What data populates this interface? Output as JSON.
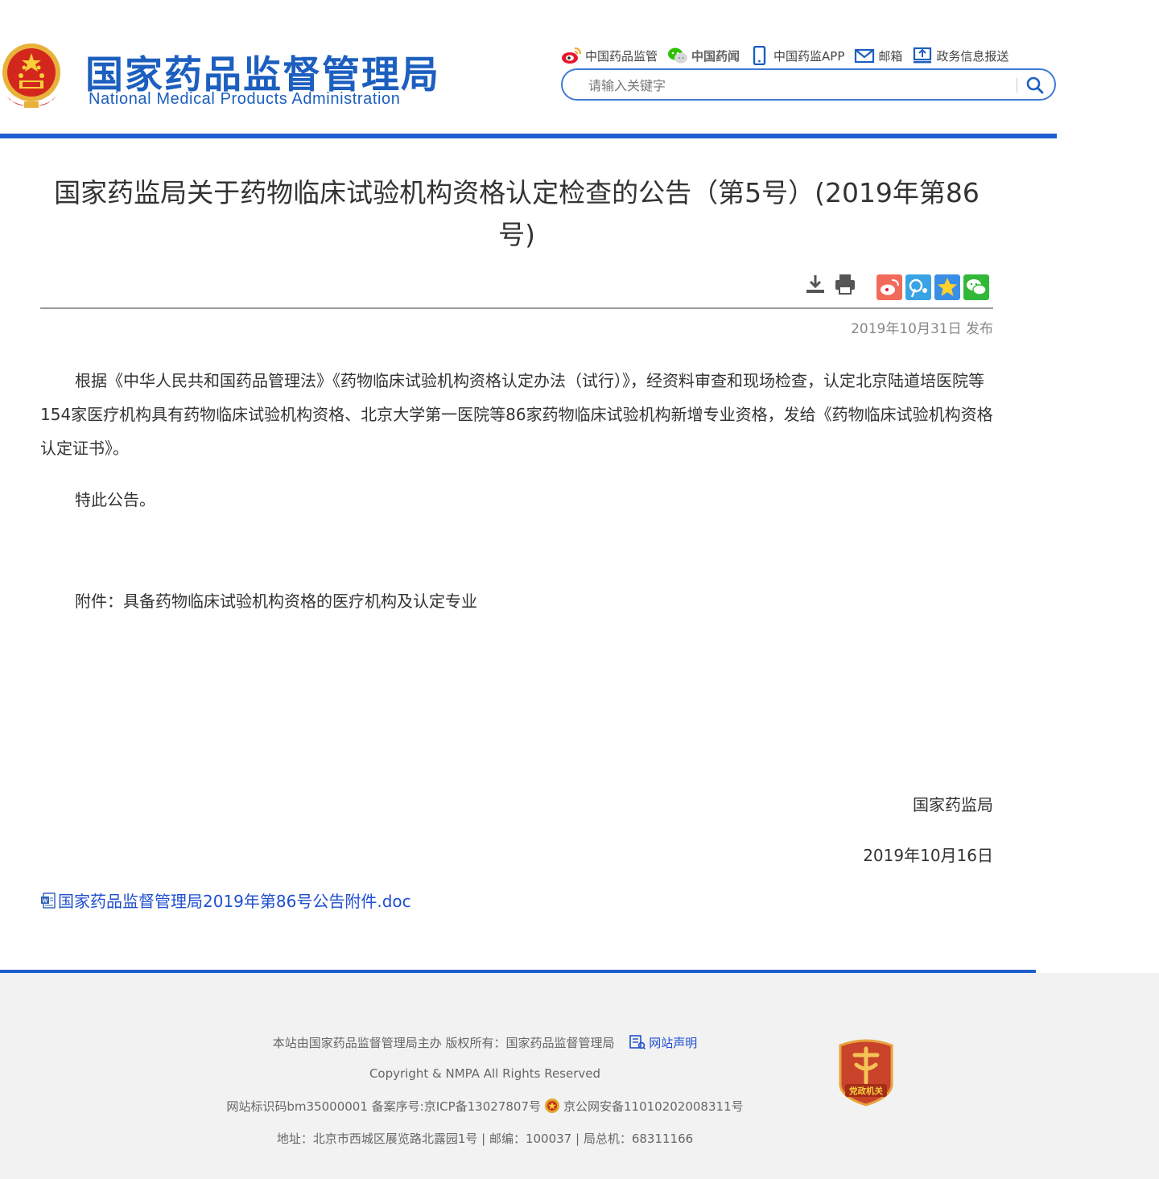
{
  "header": {
    "brand_cn": "国家药品监督管理局",
    "brand_en": "National Medical Products Administration",
    "links": [
      {
        "label": "中国药品监管",
        "icon": "weibo-icon"
      },
      {
        "label": "中国药闻",
        "icon": "wechat-icon"
      },
      {
        "label": "中国药监APP",
        "icon": "mobile-icon"
      },
      {
        "label": "邮箱",
        "icon": "mail-icon"
      },
      {
        "label": "政务信息报送",
        "icon": "upload-monitor-icon"
      }
    ],
    "search_placeholder": "请输入关键字"
  },
  "article": {
    "title": "国家药监局关于药物临床试验机构资格认定检查的公告（第5号）(2019年第86号)",
    "pubdate": "2019年10月31日 发布",
    "paragraphs": [
      "根据《中华人民共和国药品管理法》《药物临床试验机构资格认定办法（试行）》，经资料审查和现场检查，认定北京陆道培医院等154家医疗机构具有药物临床试验机构资格、北京大学第一医院等86家药物临床试验机构新增专业资格，发给《药物临床试验机构资格认定证书》。",
      "特此公告。",
      "附件：具备药物临床试验机构资格的医疗机构及认定专业"
    ],
    "signature_org": "国家药监局",
    "signature_date": "2019年10月16日",
    "attachment": "国家药品监督管理局2019年第86号公告附件.doc"
  },
  "footer": {
    "sponsor": "本站由国家药品监督管理局主办  版权所有：国家药品监督管理局",
    "statement": "网站声明",
    "copyright": "Copyright & NMPA All Rights Reserved",
    "icp": "网站标识码bm35000001 备案序号:京ICP备13027807号",
    "police": "京公网安备11010202008311号",
    "address": "地址：北京市西城区展览路北露园1号 | 邮编：100037 | 局总机：68311166",
    "party_badge": "党政机关"
  },
  "colors": {
    "brand_blue": "#1c5fbf",
    "rule_blue": "#1d5fcf",
    "link_blue": "#1f4fcf",
    "footer_bg": "#f2f2f2"
  }
}
